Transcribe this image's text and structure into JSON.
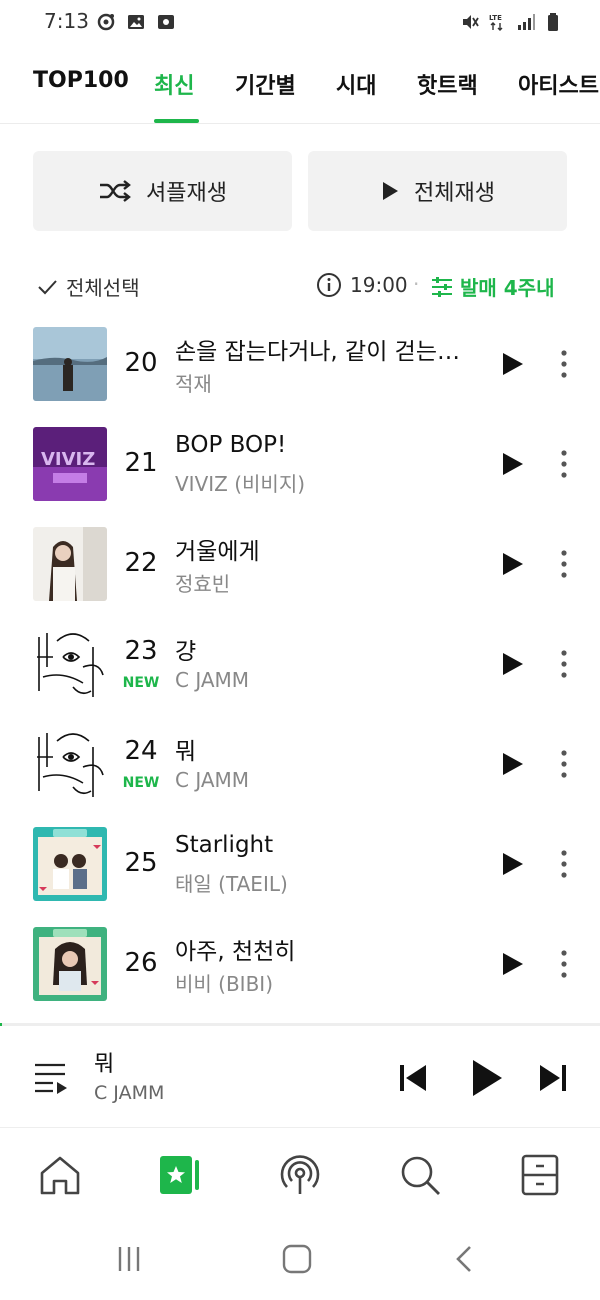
{
  "status_bar": {
    "time": "7:13",
    "left_icons": [
      "record-icon",
      "image-icon",
      "media-icon"
    ],
    "right_icons": [
      "mute-icon",
      "lte-icon",
      "signal-icon",
      "battery-icon"
    ]
  },
  "tabs": [
    {
      "label": "TOP100",
      "active": false
    },
    {
      "label": "최신",
      "active": true
    },
    {
      "label": "기간별",
      "active": false
    },
    {
      "label": "시대",
      "active": false
    },
    {
      "label": "핫트랙",
      "active": false
    },
    {
      "label": "아티스트",
      "active": false
    }
  ],
  "actions": {
    "shuffle_label": "셔플재생",
    "play_all_label": "전체재생"
  },
  "selection": {
    "select_all_label": "전체선택",
    "update_time": "19:00",
    "separator": "·",
    "filter_label": "발매 4주내"
  },
  "tracks": [
    {
      "rank": "20",
      "title": "손을 잡는다거나, 같이 걷는다거나",
      "artist": "적재",
      "badge": "",
      "art": "sea"
    },
    {
      "rank": "21",
      "title": "BOP BOP!",
      "artist": "VIVIZ (비비지)",
      "badge": "",
      "art": "purple"
    },
    {
      "rank": "22",
      "title": "거울에게",
      "artist": "정효빈",
      "badge": "",
      "art": "white-portrait"
    },
    {
      "rank": "23",
      "title": "걍",
      "artist": "C JAMM",
      "badge": "NEW",
      "art": "sketch"
    },
    {
      "rank": "24",
      "title": "뭐",
      "artist": "C JAMM",
      "badge": "NEW",
      "art": "sketch"
    },
    {
      "rank": "25",
      "title": "Starlight",
      "artist": "태일 (TAEIL)",
      "badge": "",
      "art": "teal-frame"
    },
    {
      "rank": "26",
      "title": "아주, 천천히",
      "artist": "비비 (BIBI)",
      "badge": "",
      "art": "green-frame"
    }
  ],
  "now_playing": {
    "title": "뭐",
    "artist": "C JAMM"
  },
  "bottom_nav": [
    "home-icon",
    "chart-icon",
    "podcast-icon",
    "search-icon",
    "library-icon"
  ],
  "colors": {
    "accent": "#1eb64b",
    "text": "#111111",
    "subtext": "#888888",
    "button_bg": "#f2f2f2"
  }
}
